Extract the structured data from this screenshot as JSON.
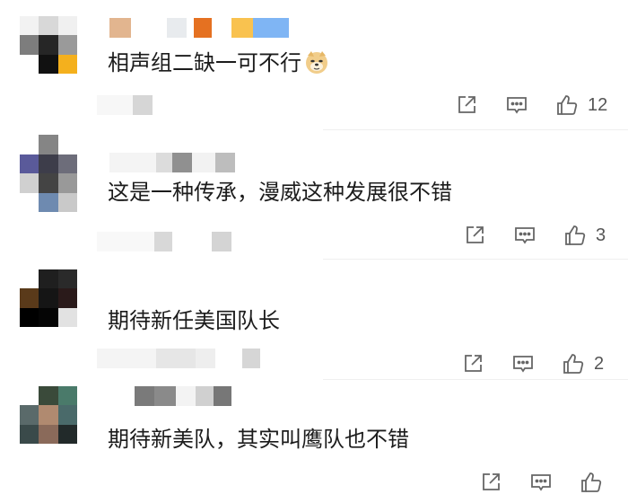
{
  "comments": [
    {
      "text": "相声组二缺一可不行",
      "emoji": "doge-emoji",
      "likes": "12"
    },
    {
      "text": "这是一种传承，漫威这种发展很不错",
      "likes": "3"
    },
    {
      "text": "期待新任美国队长",
      "likes": "2"
    },
    {
      "text": "期待新美队，其实叫鹰队也不错",
      "likes": ""
    }
  ],
  "icons": {
    "share": "share-icon",
    "reply": "comment-icon",
    "like": "thumbs-up-icon"
  },
  "colors": {
    "text": "#1c1c1c",
    "icon": "#666666",
    "count": "#555555"
  }
}
